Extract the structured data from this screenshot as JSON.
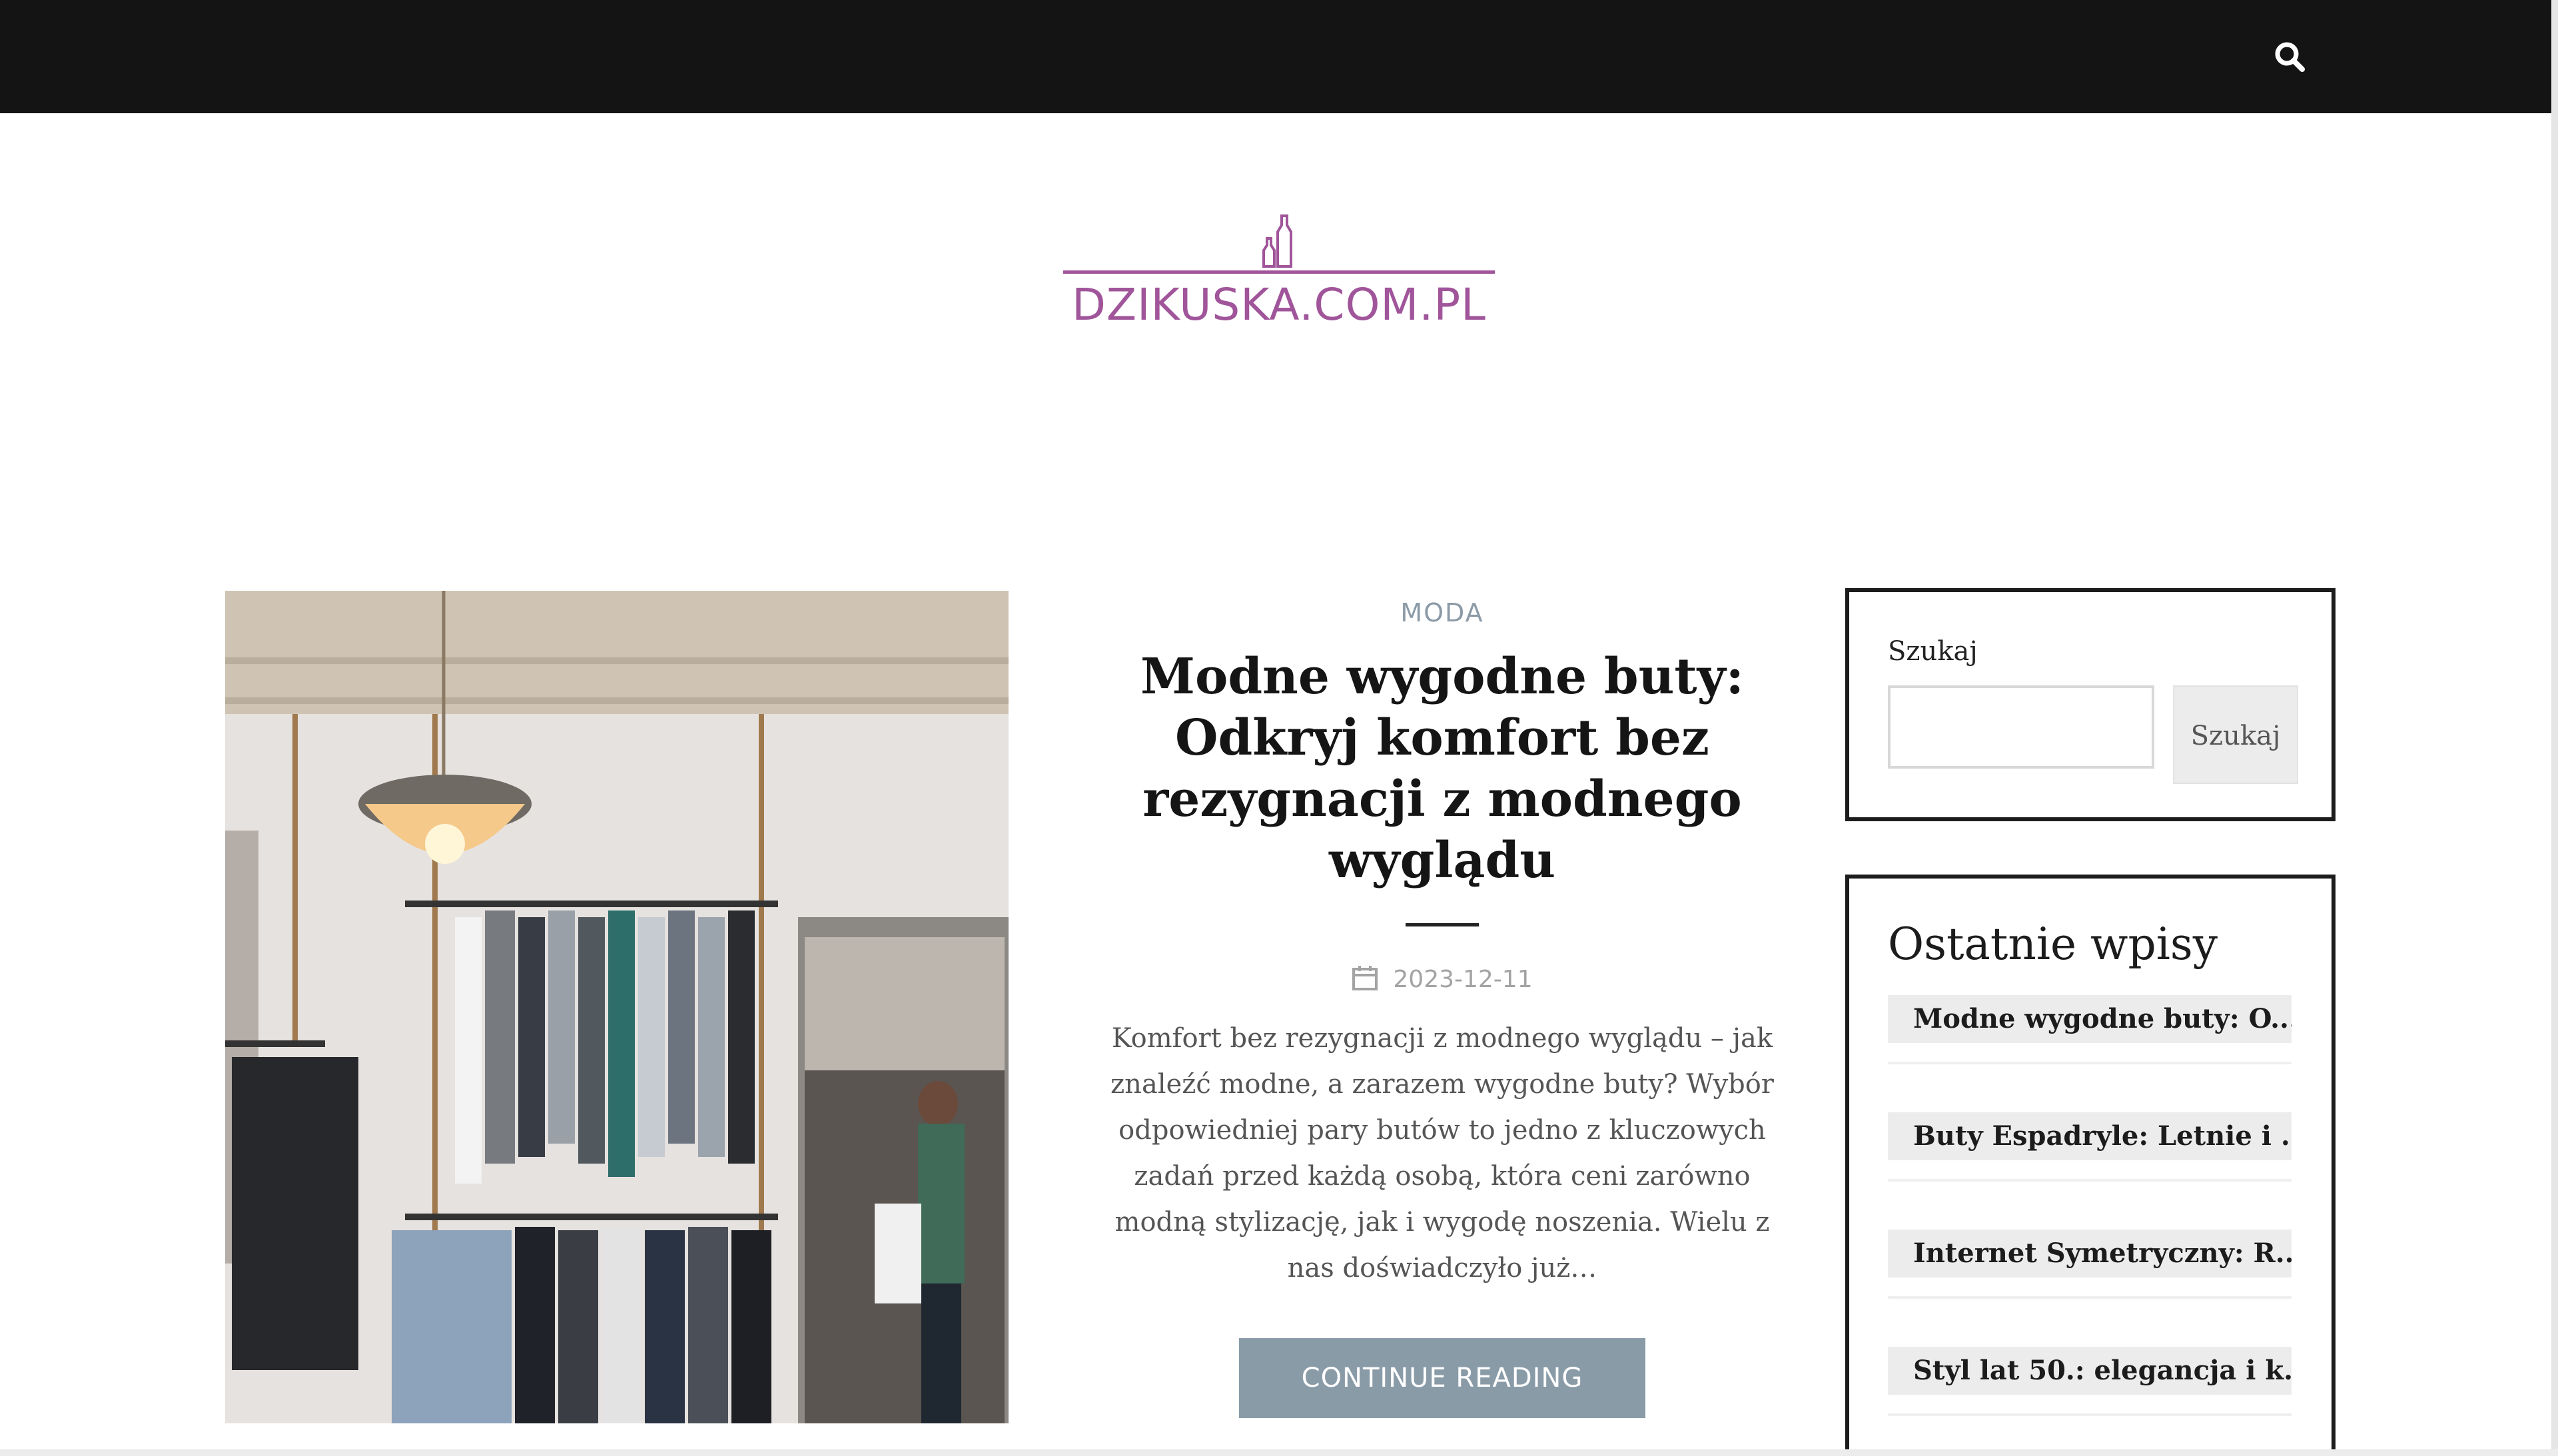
{
  "header": {
    "search_icon": "search-icon",
    "background": "#141414"
  },
  "logo": {
    "text": "DZIKUSKA.COM.PL",
    "color": "#a0559a"
  },
  "post": {
    "category": "MODA",
    "title": "Modne wygodne buty: Odkryj komfort bez rezygnacji z modnego wyglądu",
    "date_icon": "calendar-icon",
    "date": "2023-12-11",
    "excerpt": "Komfort bez rezygnacji z modnego wyglądu – jak znaleźć modne, a zarazem wygodne buty? Wybór odpowiedniej pary butów to jedno z kluczowych zadań przed każdą osobą, która ceni zarówno modną stylizację, jak i wygodę noszenia. Wielu z nas doświadczyło już…",
    "continue_label": "CONTINUE READING",
    "button_color": "#8a9ba8"
  },
  "sidebar": {
    "search": {
      "label": "Szukaj",
      "input_value": "",
      "button_label": "Szukaj"
    },
    "recent": {
      "heading": "Ostatnie wpisy",
      "items": [
        "Modne wygodne buty: O...",
        "Buty Espadryle: Letnie i ...",
        "Internet Symetryczny: R...",
        "Styl lat 50.: elegancja i k..."
      ]
    }
  }
}
